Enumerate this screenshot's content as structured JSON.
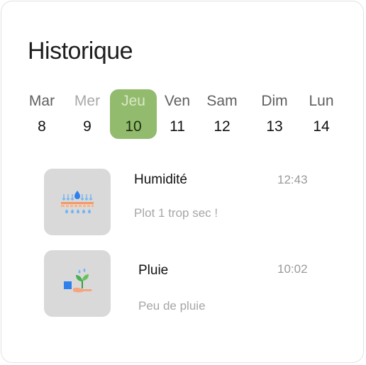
{
  "header": {
    "title": "Historique"
  },
  "calendar": {
    "days": [
      {
        "name": "Mar",
        "num": "8"
      },
      {
        "name": "Mer",
        "num": "9"
      },
      {
        "name": "Jeu",
        "num": "10"
      },
      {
        "name": "Ven",
        "num": "11"
      },
      {
        "name": "Sam",
        "num": "12"
      },
      {
        "name": "Dim",
        "num": "13"
      },
      {
        "name": "Lun",
        "num": "14"
      }
    ],
    "selected_day": "10",
    "selected_color": "#92bb6d"
  },
  "notifications": [
    {
      "title": "Humidité",
      "time": "12:43",
      "message": "Plot 1 trop sec !",
      "icon": "humidity-icon"
    },
    {
      "title": "Pluie",
      "time": "10:02",
      "message": "Peu de pluie",
      "icon": "rain-plant-icon"
    }
  ]
}
